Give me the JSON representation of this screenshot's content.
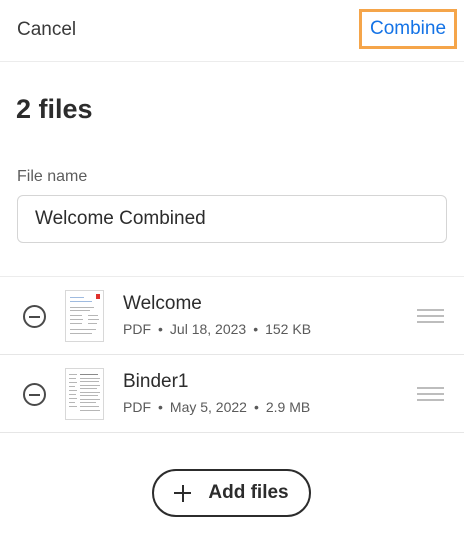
{
  "header": {
    "cancel_label": "Cancel",
    "combine_label": "Combine",
    "combine_highlight_color": "#f5a54a",
    "accent_color": "#1473e6"
  },
  "title": "2 files",
  "file_name": {
    "label": "File name",
    "value": "Welcome Combined"
  },
  "files": [
    {
      "name": "Welcome",
      "type": "PDF",
      "date": "Jul 18, 2023",
      "size": "152 KB",
      "thumbnail": "welcome-doc-thumbnail"
    },
    {
      "name": "Binder1",
      "type": "PDF",
      "date": "May 5, 2022",
      "size": "2.9 MB",
      "thumbnail": "binder-doc-thumbnail"
    }
  ],
  "add_files_label": "Add files",
  "icons": {
    "remove": "minus-circle-icon",
    "drag": "drag-handle-icon",
    "add": "plus-icon"
  }
}
